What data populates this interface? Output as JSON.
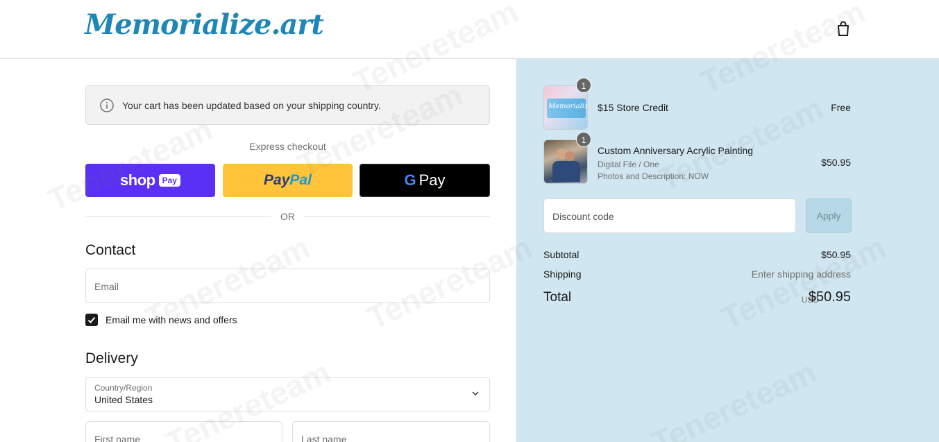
{
  "header": {
    "logo_text": "Memorialize.art",
    "cart_icon": "shopping-bag-icon"
  },
  "notice": {
    "icon": "info-icon",
    "text": "Your cart has been updated based on your shipping country."
  },
  "express": {
    "label": "Express checkout",
    "shop_word": "shop",
    "shop_pay": "Pay",
    "paypal_1": "Pay",
    "paypal_2": "Pal",
    "gpay_g": "G",
    "gpay_word": "Pay",
    "or": "OR"
  },
  "contact": {
    "title": "Contact",
    "email_placeholder": "Email",
    "newsletter_label": "Email me with news and offers",
    "newsletter_checked": true
  },
  "delivery": {
    "title": "Delivery",
    "country_label": "Country/Region",
    "country_value": "United States",
    "first_name_placeholder": "First name",
    "last_name_placeholder": "Last name"
  },
  "cart": {
    "items": [
      {
        "name": "$15 Store Credit",
        "qty": "1",
        "price": "Free",
        "variant": "",
        "note": "",
        "thumb_text": "Memorialize"
      },
      {
        "name": "Custom Anniversary Acrylic Painting",
        "qty": "1",
        "price": "$50.95",
        "variant": "Digital File / One",
        "note": "Photos and Description: NOW"
      }
    ],
    "discount_placeholder": "Discount code",
    "apply_label": "Apply",
    "subtotal_label": "Subtotal",
    "subtotal_value": "$50.95",
    "shipping_label": "Shipping",
    "shipping_value": "Enter shipping address",
    "total_label": "Total",
    "total_currency": "USD",
    "total_value": "$50.95"
  },
  "watermark": "Tenereteam",
  "colors": {
    "brand": "#1f87b6",
    "shop_pay": "#5a31f4",
    "paypal": "#ffc439",
    "summary_bg": "#d0e6f0"
  }
}
